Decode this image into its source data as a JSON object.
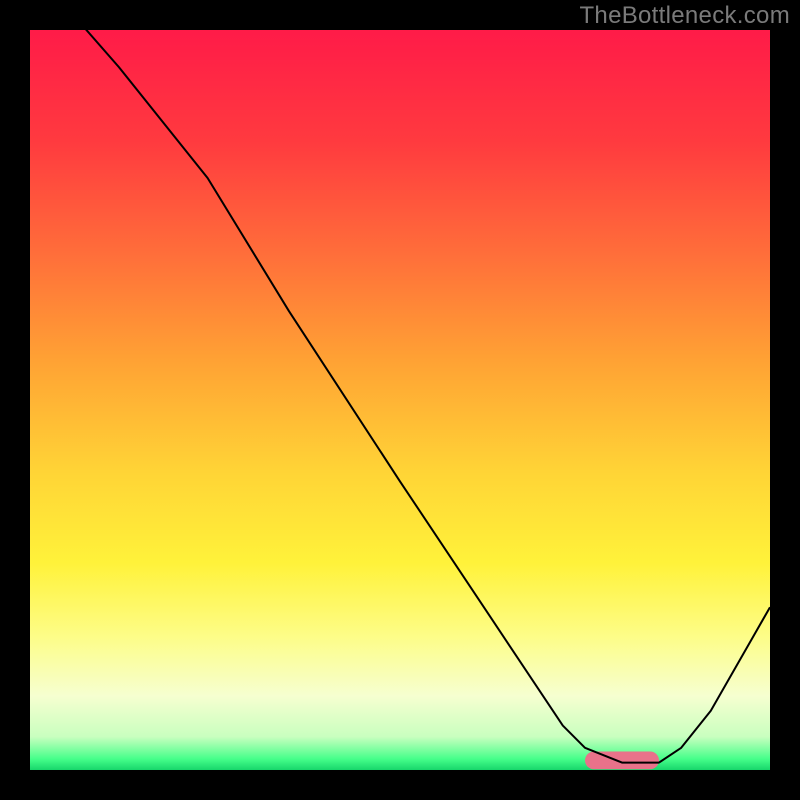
{
  "watermark": "TheBottleneck.com",
  "chart_data": {
    "type": "line",
    "title": "",
    "xlabel": "",
    "ylabel": "",
    "xlim": [
      0,
      100
    ],
    "ylim": [
      0,
      100
    ],
    "axes_visible": false,
    "grid": false,
    "background_gradient": {
      "orientation": "vertical",
      "stops": [
        {
          "pos": 0.0,
          "color": "#ff1b48"
        },
        {
          "pos": 0.15,
          "color": "#ff3a3f"
        },
        {
          "pos": 0.3,
          "color": "#ff6d3a"
        },
        {
          "pos": 0.45,
          "color": "#ffa334"
        },
        {
          "pos": 0.6,
          "color": "#ffd536"
        },
        {
          "pos": 0.72,
          "color": "#fff23a"
        },
        {
          "pos": 0.82,
          "color": "#fdfd88"
        },
        {
          "pos": 0.9,
          "color": "#f6ffd0"
        },
        {
          "pos": 0.955,
          "color": "#c9ffbf"
        },
        {
          "pos": 0.985,
          "color": "#46ff8a"
        },
        {
          "pos": 1.0,
          "color": "#17d66b"
        }
      ]
    },
    "series": [
      {
        "name": "bottleneck-curve",
        "color": "#000000",
        "width": 2,
        "x": [
          0,
          5,
          12,
          20,
          24,
          35,
          50,
          62,
          72,
          75,
          80,
          85,
          88,
          92,
          100
        ],
        "values": [
          108,
          103,
          95,
          85,
          80,
          62,
          39,
          21,
          6,
          3,
          1,
          1,
          3,
          8,
          22
        ]
      }
    ],
    "annotations": [
      {
        "name": "optimal-bar",
        "shape": "rounded-rect",
        "x_range": [
          75,
          85
        ],
        "y": 1.3,
        "height": 2.4,
        "color": "#e9728a"
      }
    ]
  }
}
